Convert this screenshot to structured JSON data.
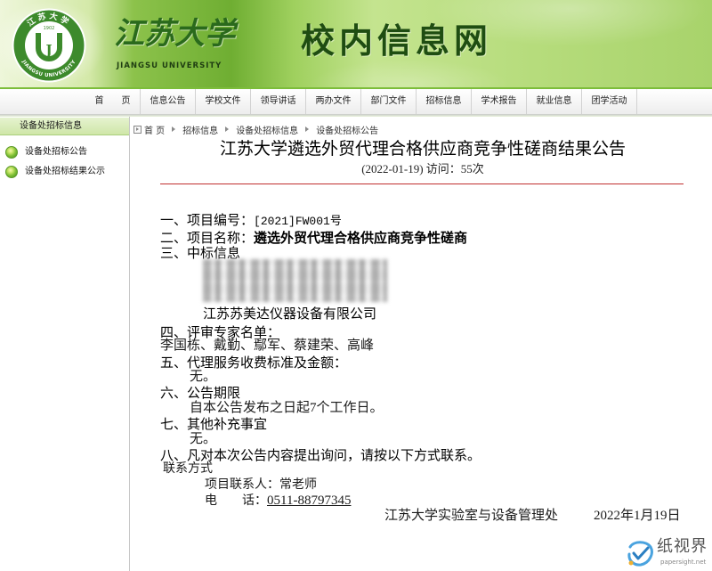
{
  "header": {
    "logo": {
      "ring_top": "江苏大学",
      "ring_bottom": "JIANGSU UNIVERSITY",
      "year": "1902",
      "letter": "J"
    },
    "school_name_cn": "江苏大学",
    "school_name_en": "JIANGSU UNIVERSITY",
    "site_name": "校内信息网"
  },
  "nav": {
    "items": [
      "首　　页",
      "信息公告",
      "学校文件",
      "领导讲话",
      "两办文件",
      "部门文件",
      "招标信息",
      "学术报告",
      "就业信息",
      "团学活动"
    ]
  },
  "sidebar": {
    "title": "设备处招标信息",
    "items": [
      {
        "label": "设备处招标公告",
        "icon": "green-ball-icon"
      },
      {
        "label": "设备处招标结果公示",
        "icon": "green-ball-icon"
      }
    ]
  },
  "breadcrumb": {
    "icon": "location-icon",
    "separator_icon": "triangle-right-icon",
    "items": [
      "首 页",
      "招标信息",
      "设备处招标信息",
      "设备处招标公告"
    ]
  },
  "article": {
    "title": "江苏大学遴选外贸代理合格供应商竞争性磋商结果公告",
    "meta": "(2022-01-19) 访问：55次",
    "project_no_label": "一、项目编号：",
    "project_no": "[2021]FW001号",
    "project_name_label": "二、项目名称：",
    "project_name": "遴选外贸代理合格供应商竞争性磋商",
    "winner_label": "三、中标信息",
    "winner": "江苏苏美达仪器设备有限公司",
    "experts_label": "四、评审专家名单：",
    "experts": "李国栋、戴勤、鄢军、蔡建荣、高峰",
    "fee_label": "五、代理服务收费标准及金额：",
    "fee": "无。",
    "period_label": "六、公告期限",
    "period": "自本公告发布之日起7个工作日。",
    "other_label": "七、其他补充事宜",
    "other": "无。",
    "contact_intro": "八、凡对本次公告内容提出询问，请按以下方式联系。",
    "contact_heading": "联系方式",
    "contact_person_label": "项目联系人：",
    "contact_person": "常老师",
    "phone_label": "电　　话：",
    "phone": "0511-88797345",
    "signature_org": "江苏大学实验室与设备管理处",
    "signature_date": "2022年1月19日"
  },
  "watermark": {
    "name": "纸视界",
    "url": "papersight.net",
    "icon": "papersight-logo-icon"
  },
  "colors": {
    "header_green": "#6fae32",
    "title_green": "#2a6a1c",
    "divider_red": "#c03030",
    "sidebar_header_bg": "#cfe6a8"
  }
}
